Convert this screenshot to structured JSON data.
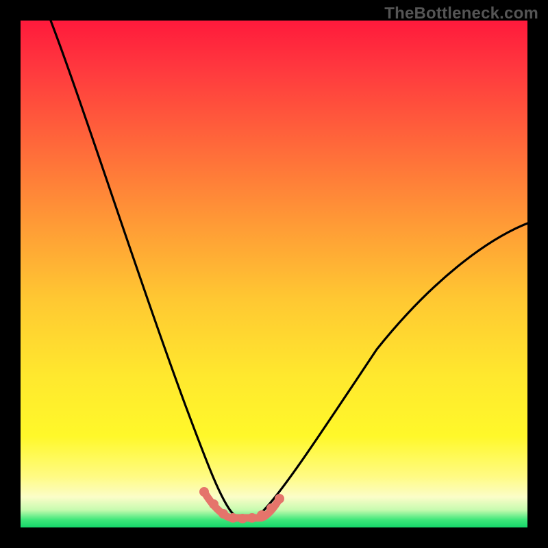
{
  "watermark": "TheBottleneck.com",
  "chart_data": {
    "type": "line",
    "title": "",
    "xlabel": "",
    "ylabel": "",
    "xlim": [
      0,
      100
    ],
    "ylim": [
      0,
      100
    ],
    "series": [
      {
        "name": "black-curve",
        "color": "#000000",
        "x": [
          6,
          10,
          14,
          18,
          22,
          26,
          30,
          33,
          35,
          37,
          39,
          41,
          43,
          45,
          47,
          50,
          54,
          58,
          62,
          66,
          70,
          75,
          80,
          85,
          90,
          95,
          100
        ],
        "y": [
          100,
          88,
          76,
          65,
          54,
          44,
          34,
          25,
          18,
          12,
          7,
          4,
          2,
          1.6,
          2,
          4,
          8,
          13,
          19,
          25,
          31,
          37,
          43,
          48,
          52,
          56,
          60
        ]
      },
      {
        "name": "pink-valley-points",
        "color": "#e5746b",
        "x": [
          36,
          38,
          40,
          42,
          44,
          46,
          48,
          50
        ],
        "y": [
          7.5,
          5,
          3,
          2,
          1.6,
          2,
          3.5,
          5.5
        ]
      }
    ],
    "gradient_stops": [
      {
        "pos": 0,
        "color": "#ff1a3c"
      },
      {
        "pos": 0.55,
        "color": "#ffc832"
      },
      {
        "pos": 0.82,
        "color": "#fff82a"
      },
      {
        "pos": 1.0,
        "color": "#15d66a"
      }
    ]
  }
}
